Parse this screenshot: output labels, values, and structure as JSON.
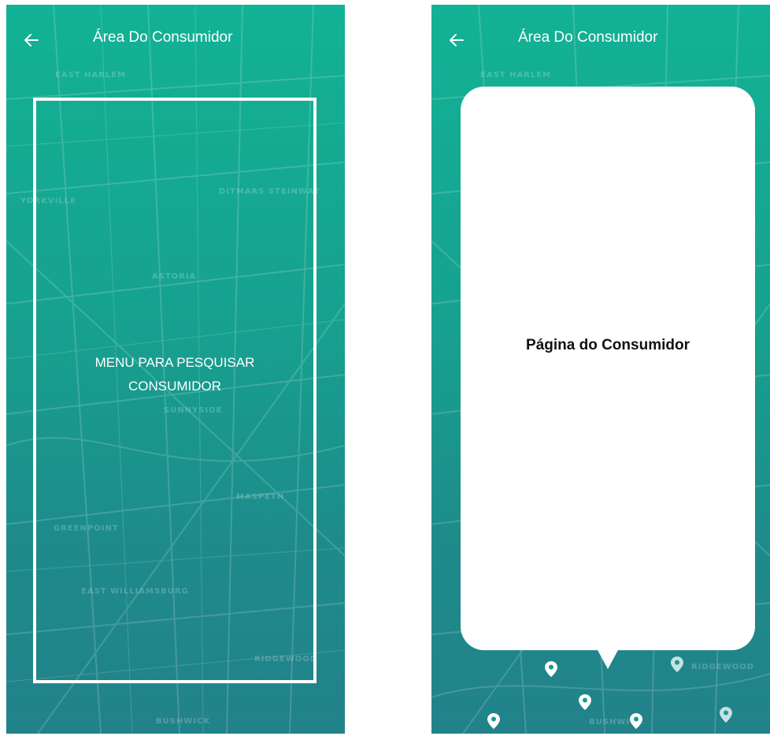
{
  "screens": [
    {
      "header": {
        "back_icon": "arrow-left-icon",
        "title": "Área Do Consumidor"
      },
      "search_panel": {
        "line1": "MENU PARA PESQUISAR",
        "line2": "CONSUMIDOR"
      },
      "map_labels": [
        "EAST HARLEM",
        "YORKVILLE",
        "DITMARS STEINWAY",
        "ASTORIA",
        "SUNNYSIDE",
        "MASPETH",
        "GREENPOINT",
        "EAST WILLIAMSBURG",
        "RIDGEWOOD",
        "BUSHWICK"
      ]
    },
    {
      "header": {
        "back_icon": "arrow-left-icon",
        "title": "Área Do Consumidor"
      },
      "consumer_card": {
        "title": "Página do Consumidor"
      },
      "map_labels": [
        "EAST HARLEM",
        "RIDGEWOOD",
        "BUSHWICK"
      ],
      "pin_icon": "map-pin-icon"
    }
  ],
  "colors": {
    "gradient_top": "#12b295",
    "gradient_bottom": "#22828a",
    "card": "#ffffff"
  }
}
